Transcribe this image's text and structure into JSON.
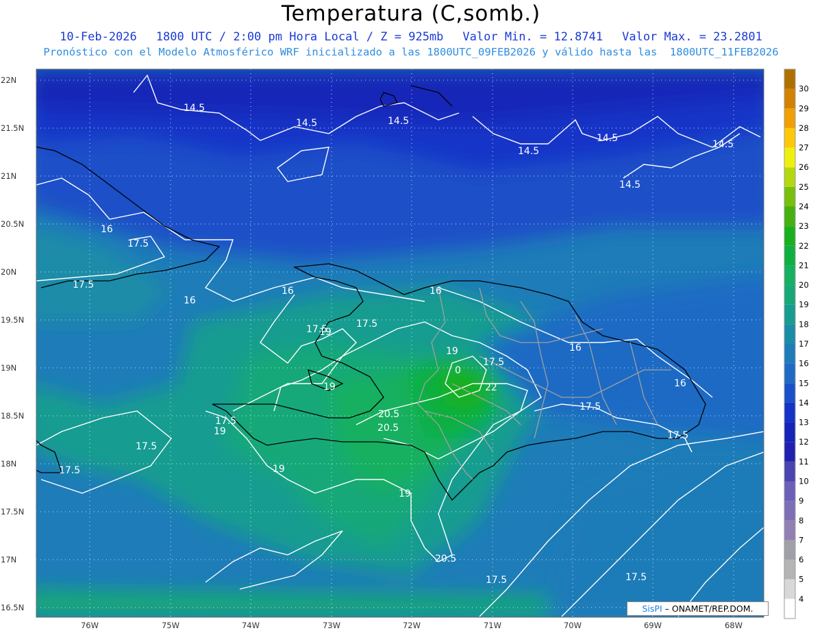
{
  "header": {
    "title": "Temperatura (C,somb.)",
    "date": "10-Feb-2026",
    "time_info": "1800 UTC / 2:00 pm Hora Local / Z = 925mb",
    "min_value": "Valor Min. = 12.8741",
    "max_value": "Valor Max. = 23.2801",
    "forecast_line": "Pronóstico con el Modelo Atmosférico WRF inicializado a las 1800UTC_09FEB2026 y válido hasta las  1800UTC_11FEB2026"
  },
  "axes": {
    "lat_labels": [
      "22N",
      "21.5N",
      "21N",
      "20.5N",
      "20N",
      "19.5N",
      "19N",
      "18.5N",
      "18N",
      "17.5N",
      "17N",
      "16.5N"
    ],
    "lon_labels": [
      "76W",
      "75W",
      "74W",
      "73W",
      "72W",
      "71W",
      "70W",
      "69W",
      "68W"
    ]
  },
  "colorbar": {
    "levels": [
      "4",
      "5",
      "6",
      "7",
      "8",
      "9",
      "10",
      "11",
      "12",
      "13",
      "14",
      "15",
      "16",
      "17",
      "18",
      "19",
      "20",
      "21",
      "22",
      "23",
      "24",
      "25",
      "26",
      "27",
      "28",
      "29",
      "30"
    ],
    "colors": [
      "#ffffff",
      "#d8d8d8",
      "#b4b4b4",
      "#a0a0a8",
      "#9080b4",
      "#7e6eb8",
      "#6a60b8",
      "#4a44b0",
      "#2020b0",
      "#1424b8",
      "#1434c8",
      "#1a50c8",
      "#1e6ac4",
      "#1e7cb8",
      "#1a8ca8",
      "#189c90",
      "#18a878",
      "#16b060",
      "#10b040",
      "#18b01c",
      "#46b010",
      "#78c00c",
      "#b4d80e",
      "#f0f010",
      "#ffc80a",
      "#f0a004",
      "#d28200",
      "#b07000"
    ]
  },
  "contour_labels": [
    "14.5",
    "14.5",
    "14.5",
    "14.5",
    "14.5",
    "14.5",
    "14.5",
    "16",
    "16",
    "16",
    "16",
    "16",
    "16",
    "17.5",
    "17.5",
    "17.5",
    "17.5",
    "17.5",
    "17.5",
    "17.5",
    "17.5",
    "17.5",
    "17.5",
    "17.5",
    "17.5",
    "19",
    "19",
    "19",
    "19",
    "19",
    "19",
    "20.5",
    "20.5",
    "20.5",
    "22",
    "0"
  ],
  "credit": {
    "brand": "SisPI",
    "org": " – ONAMET/REP.DOM."
  }
}
